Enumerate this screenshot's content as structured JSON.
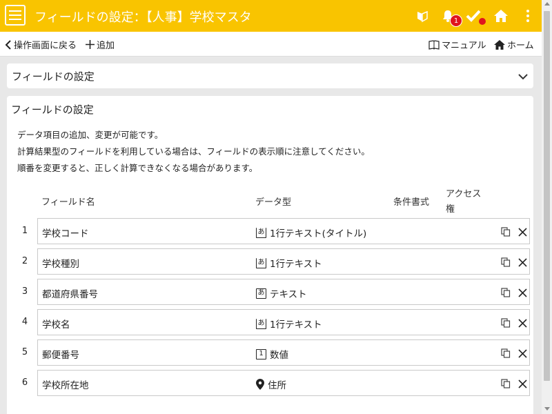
{
  "header": {
    "title": "フィールドの設定：【人事】学校マスタ",
    "notification_count": "1",
    "icons": [
      "beginner-icon",
      "bell-icon",
      "check-icon",
      "home-icon",
      "more-vert-icon"
    ],
    "accent_color": "#f9c400",
    "alert_color": "#e0141e"
  },
  "toolbar": {
    "back_label": "操作画面に戻る",
    "add_label": "追加",
    "manual_label": "マニュアル",
    "home_label": "ホーム"
  },
  "collapsed_panel": {
    "title": "フィールドの設定"
  },
  "main_panel": {
    "title": "フィールドの設定",
    "description": [
      "データ項目の追加、変更が可能です。",
      "計算結果型のフィールドを利用している場合は、フィールドの表示順に注意してください。",
      "順番を変更すると、正しく計算できなくなる場合があります。"
    ],
    "columns": {
      "name": "フィールド名",
      "type": "データ型",
      "conditional_format": "条件書式",
      "access_line1": "アクセス",
      "access_line2": "権"
    },
    "rows": [
      {
        "num": "1",
        "name": "学校コード",
        "type_icon": "あ",
        "type_icon_style": "underline",
        "type": "1行テキスト(タイトル)"
      },
      {
        "num": "2",
        "name": "学校種別",
        "type_icon": "あ",
        "type_icon_style": "underline",
        "type": "1行テキスト"
      },
      {
        "num": "3",
        "name": "都道府県番号",
        "type_icon": "あ",
        "type_icon_style": "box",
        "type": "テキスト"
      },
      {
        "num": "4",
        "name": "学校名",
        "type_icon": "あ",
        "type_icon_style": "underline",
        "type": "1行テキスト"
      },
      {
        "num": "5",
        "name": "郵便番号",
        "type_icon": "1",
        "type_icon_style": "box",
        "type": "数値"
      },
      {
        "num": "6",
        "name": "学校所在地",
        "type_icon": "pin",
        "type_icon_style": "pin",
        "type": "住所"
      }
    ]
  }
}
